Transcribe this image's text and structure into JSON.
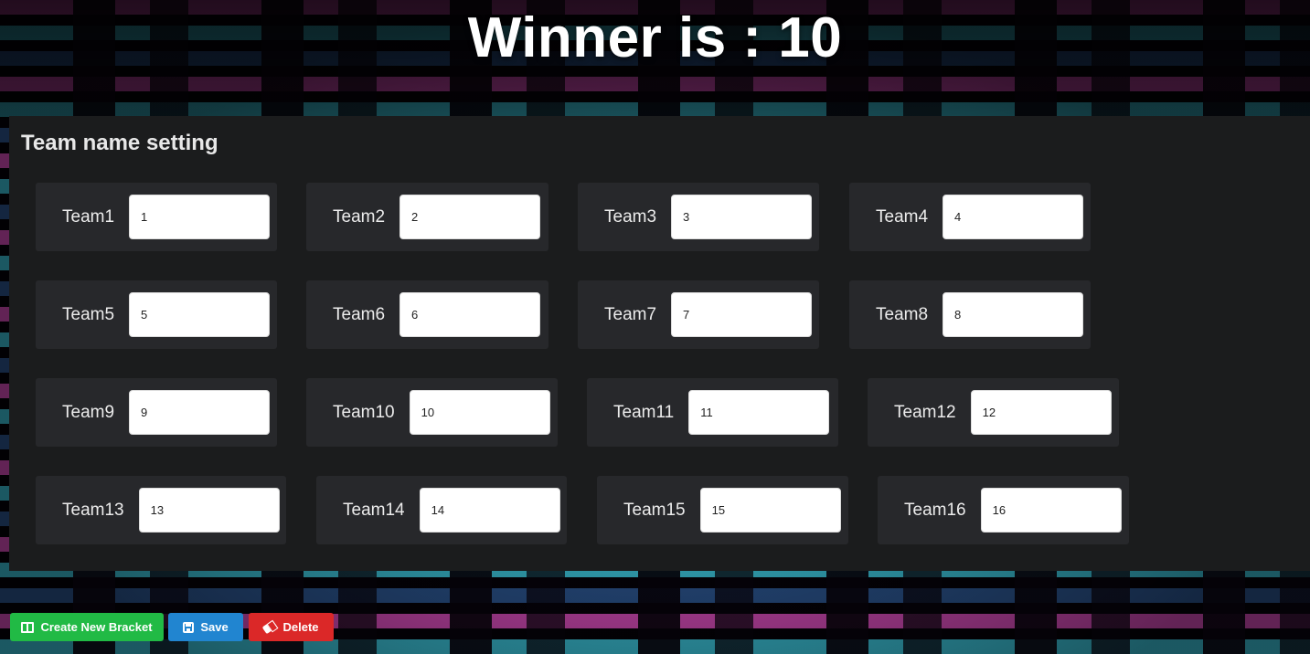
{
  "header": {
    "winner_text": "Winner is : 10"
  },
  "panel": {
    "title": "Team name setting",
    "teams": [
      {
        "label": "Team1",
        "value": "1"
      },
      {
        "label": "Team2",
        "value": "2"
      },
      {
        "label": "Team3",
        "value": "3"
      },
      {
        "label": "Team4",
        "value": "4"
      },
      {
        "label": "Team5",
        "value": "5"
      },
      {
        "label": "Team6",
        "value": "6"
      },
      {
        "label": "Team7",
        "value": "7"
      },
      {
        "label": "Team8",
        "value": "8"
      },
      {
        "label": "Team9",
        "value": "9"
      },
      {
        "label": "Team10",
        "value": "10"
      },
      {
        "label": "Team11",
        "value": "11"
      },
      {
        "label": "Team12",
        "value": "12"
      },
      {
        "label": "Team13",
        "value": "13"
      },
      {
        "label": "Team14",
        "value": "14"
      },
      {
        "label": "Team15",
        "value": "15"
      },
      {
        "label": "Team16",
        "value": "16"
      }
    ]
  },
  "actions": {
    "create_label": "Create New Bracket",
    "create_icon": "columns-icon",
    "save_label": "Save",
    "save_icon": "save-icon",
    "delete_label": "Delete",
    "delete_icon": "eraser-icon"
  },
  "colors": {
    "panel_bg": "#1b1c1d",
    "card_bg": "#27282b",
    "create": "#21ba45",
    "save": "#2185d0",
    "delete": "#db2828"
  }
}
